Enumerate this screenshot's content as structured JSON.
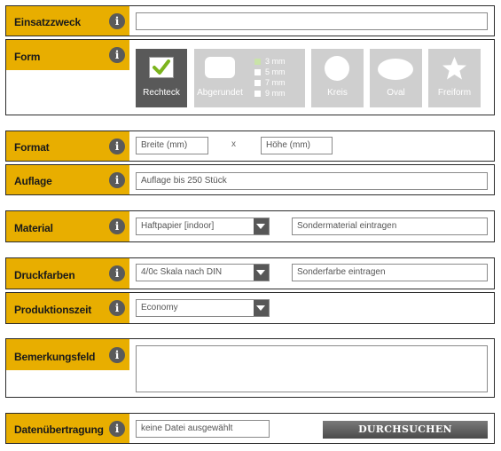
{
  "info_glyph": "i",
  "fields": {
    "einsatzzweck": {
      "label": "Einsatzzweck"
    },
    "form": {
      "label": "Form",
      "shapes": [
        {
          "label": "Rechteck",
          "selected": true
        },
        {
          "label": "Abgerundet",
          "selected": false
        },
        {
          "label": "Kreis",
          "selected": false
        },
        {
          "label": "Oval",
          "selected": false
        },
        {
          "label": "Freiform",
          "selected": false
        }
      ],
      "radius_options": [
        "3 mm",
        "5 mm",
        "7 mm",
        "9 mm"
      ]
    },
    "format": {
      "label": "Format",
      "width_placeholder": "Breite (mm)",
      "separator": "x",
      "height_placeholder": "Höhe (mm)"
    },
    "auflage": {
      "label": "Auflage",
      "placeholder": "Auflage bis 250 Stück"
    },
    "material": {
      "label": "Material",
      "selected": "Haftpapier [indoor]",
      "custom_placeholder": "Sondermaterial eintragen"
    },
    "druckfarben": {
      "label": "Druckfarben",
      "selected": "4/0c Skala nach DIN",
      "custom_placeholder": "Sonderfarbe eintragen"
    },
    "produktionszeit": {
      "label": "Produktionszeit",
      "selected": "Economy"
    },
    "bemerkungsfeld": {
      "label": "Bemerkungsfeld"
    },
    "datenuebertragung": {
      "label": "Datenübertragung",
      "file_status": "keine Datei ausgewählt",
      "browse_label": "DURCHSUCHEN"
    }
  },
  "colors": {
    "accent": "#e8ae00",
    "tile": "#cfcfcf",
    "tile_active": "#595959",
    "checkmark": "#7cb41d"
  }
}
